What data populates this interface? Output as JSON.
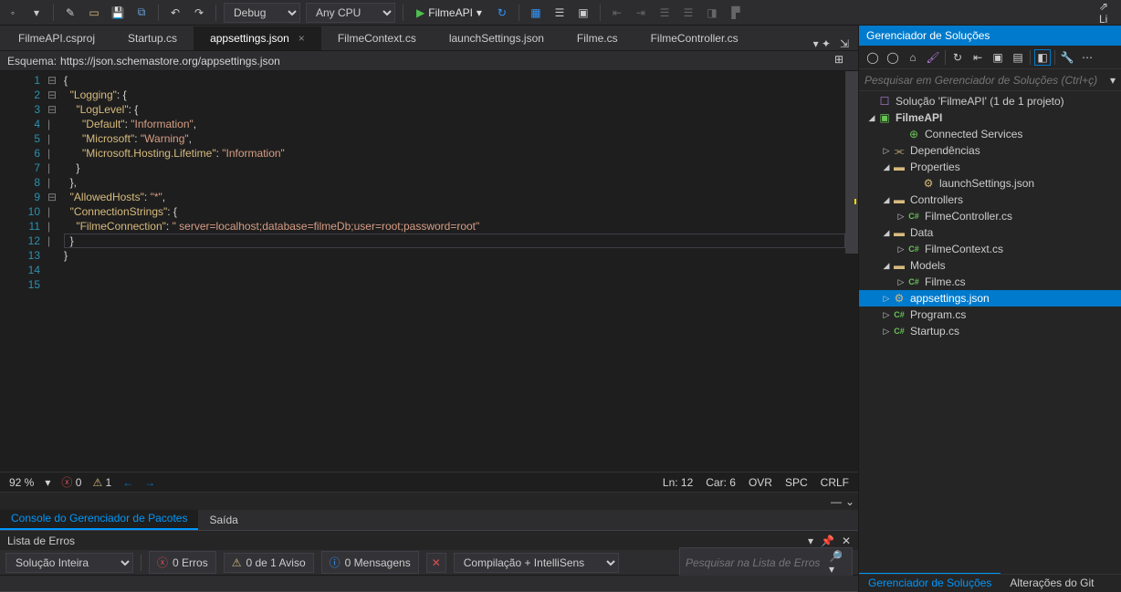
{
  "toolbar": {
    "config": "Debug",
    "platform": "Any CPU",
    "run_target": "FilmeAPI"
  },
  "tabs": [
    {
      "label": "FilmeAPI.csproj",
      "active": false
    },
    {
      "label": "Startup.cs",
      "active": false
    },
    {
      "label": "appsettings.json",
      "active": true
    },
    {
      "label": "FilmeContext.cs",
      "active": false
    },
    {
      "label": "launchSettings.json",
      "active": false
    },
    {
      "label": "Filme.cs",
      "active": false
    },
    {
      "label": "FilmeController.cs",
      "active": false
    }
  ],
  "schema": {
    "label": "Esquema:",
    "url": "https://json.schemastore.org/appsettings.json"
  },
  "code_lines": [
    {
      "n": 1,
      "fold": "⊟",
      "html": "{"
    },
    {
      "n": 2,
      "fold": "⊟",
      "html": "  <span class='k'>\"Logging\"</span>: {"
    },
    {
      "n": 3,
      "fold": "⊟",
      "html": "    <span class='k'>\"LogLevel\"</span>: {"
    },
    {
      "n": 4,
      "fold": "|",
      "html": "      <span class='k'>\"Default\"</span>: <span class='s'>\"Information\"</span>,"
    },
    {
      "n": 5,
      "fold": "|",
      "html": "      <span class='k'>\"Microsoft\"</span>: <span class='s'>\"Warning\"</span>,"
    },
    {
      "n": 6,
      "fold": "|",
      "html": "      <span class='k'>\"Microsoft.Hosting.Lifetime\"</span>: <span class='s'>\"Information\"</span>"
    },
    {
      "n": 7,
      "fold": "|",
      "html": "    }"
    },
    {
      "n": 8,
      "fold": "|",
      "html": "  },"
    },
    {
      "n": 9,
      "fold": " ",
      "html": "  <span class='k'>\"AllowedHosts\"</span>: <span class='s'>\"*\"</span>,"
    },
    {
      "n": 10,
      "fold": "⊟",
      "html": "  <span class='k'>\"ConnectionStrings\"</span>: {"
    },
    {
      "n": 11,
      "fold": "|",
      "html": "    <span class='k'>\"FilmeConnection\"</span>: <span class='s'>\" server=localhost;database=filmeDb;user=root;password=root\"</span>"
    },
    {
      "n": 12,
      "fold": "|",
      "html": "  }"
    },
    {
      "n": 13,
      "fold": "|",
      "html": "}"
    },
    {
      "n": 14,
      "fold": " ",
      "html": ""
    },
    {
      "n": 15,
      "fold": " ",
      "html": ""
    }
  ],
  "status": {
    "zoom": "92 %",
    "errors": "0",
    "warnings": "1",
    "line": "Ln: 12",
    "col": "Car: 6",
    "ovr": "OVR",
    "spc": "SPC",
    "eol": "CRLF"
  },
  "output_tabs": [
    {
      "label": "Console do Gerenciador de Pacotes",
      "active": true
    },
    {
      "label": "Saída",
      "active": false
    }
  ],
  "error_list": {
    "title": "Lista de Erros",
    "scope": "Solução Inteira",
    "errors": "0 Erros",
    "warnings": "0 de 1 Aviso",
    "messages": "0 Mensagens",
    "build": "Compilação + IntelliSens",
    "search_placeholder": "Pesquisar na Lista de Erros"
  },
  "solution_explorer": {
    "title": "Gerenciador de Soluções",
    "search_placeholder": "Pesquisar em Gerenciador de Soluções (Ctrl+ç)",
    "tree": [
      {
        "depth": 0,
        "arrow": "",
        "icon": "sln",
        "label": "Solução 'FilmeAPI' (1 de 1 projeto)"
      },
      {
        "depth": 0,
        "arrow": "open",
        "icon": "csproj",
        "label": "FilmeAPI",
        "bold": true
      },
      {
        "depth": 2,
        "arrow": "",
        "icon": "conn",
        "label": "Connected Services"
      },
      {
        "depth": 1,
        "arrow": "closed",
        "icon": "dep",
        "label": "Dependências"
      },
      {
        "depth": 1,
        "arrow": "open",
        "icon": "folder",
        "label": "Properties"
      },
      {
        "depth": 3,
        "arrow": "",
        "icon": "json",
        "label": "launchSettings.json"
      },
      {
        "depth": 1,
        "arrow": "open",
        "icon": "folder",
        "label": "Controllers"
      },
      {
        "depth": 2,
        "arrow": "closed",
        "icon": "cs",
        "label": "FilmeController.cs"
      },
      {
        "depth": 1,
        "arrow": "open",
        "icon": "folder",
        "label": "Data"
      },
      {
        "depth": 2,
        "arrow": "closed",
        "icon": "cs",
        "label": "FilmeContext.cs"
      },
      {
        "depth": 1,
        "arrow": "open",
        "icon": "folder",
        "label": "Models"
      },
      {
        "depth": 2,
        "arrow": "closed",
        "icon": "cs",
        "label": "Filme.cs"
      },
      {
        "depth": 1,
        "arrow": "closed",
        "icon": "json",
        "label": "appsettings.json",
        "selected": true
      },
      {
        "depth": 1,
        "arrow": "closed",
        "icon": "cs",
        "label": "Program.cs"
      },
      {
        "depth": 1,
        "arrow": "closed",
        "icon": "cs",
        "label": "Startup.cs"
      }
    ],
    "bottom_tabs": [
      {
        "label": "Gerenciador de Soluções",
        "active": true
      },
      {
        "label": "Alterações do Git",
        "active": false
      }
    ]
  }
}
